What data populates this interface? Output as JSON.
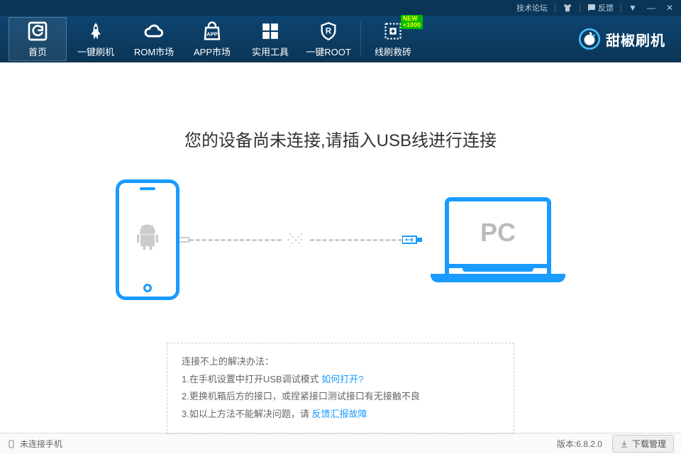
{
  "titlebar": {
    "forum": "技术论坛",
    "feedback": "反馈"
  },
  "nav": {
    "items": [
      {
        "label": "首页"
      },
      {
        "label": "一键刷机"
      },
      {
        "label": "ROM市场"
      },
      {
        "label": "APP市场"
      },
      {
        "label": "实用工具"
      },
      {
        "label": "一键ROOT"
      },
      {
        "label": "线刷救砖"
      }
    ],
    "badge_line1": "NEW",
    "badge_line2": "+1000"
  },
  "brand": {
    "name": "甜椒刷机"
  },
  "main": {
    "headline": "您的设备尚未连接,请插入USB线进行连接",
    "pc_label": "PC"
  },
  "tips": {
    "title": "连接不上的解决办法：",
    "line1_a": "1.在手机设置中打开USB调试模式 ",
    "line1_link": "如何打开?",
    "line2": "2.更换机箱后方的接口，或捏紧接口测试接口有无接触不良",
    "line3_a": "3.如以上方法不能解决问题，请 ",
    "line3_link": "反馈汇报故障"
  },
  "status": {
    "connection": "未连接手机",
    "version_label": "版本:",
    "version": "6.8.2.0",
    "download_mgr": "下载管理"
  }
}
